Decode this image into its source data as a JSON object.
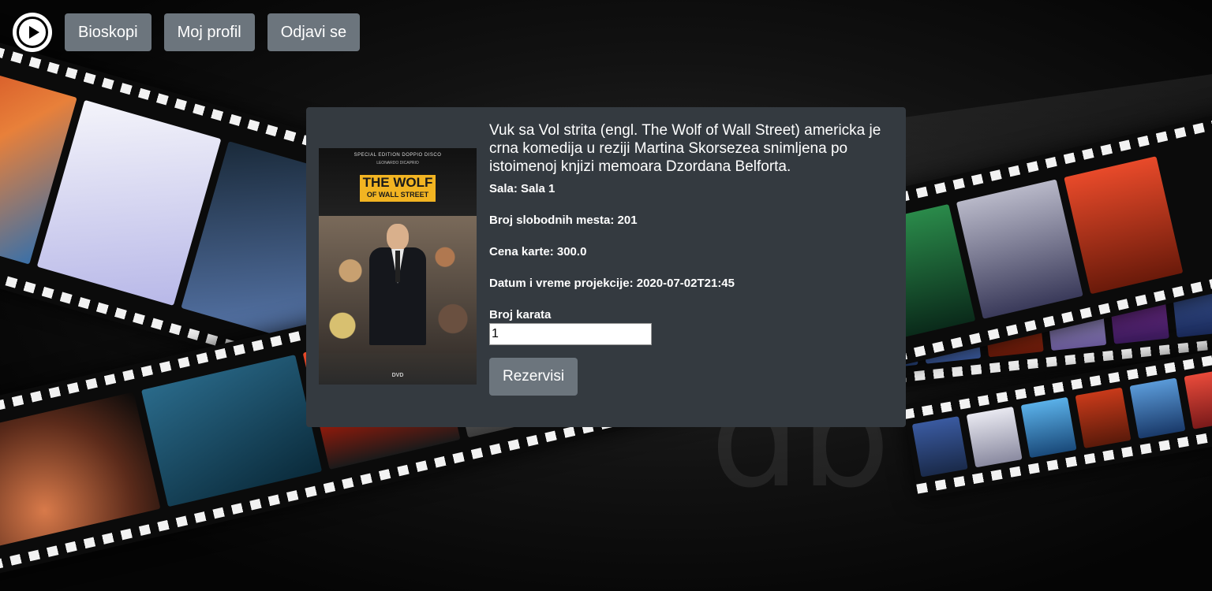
{
  "nav": {
    "logo_icon": "play-circle-icon",
    "items": [
      {
        "label": "Bioskopi"
      },
      {
        "label": "Moj profil"
      },
      {
        "label": "Odjavi se"
      }
    ]
  },
  "movie": {
    "description": "Vuk sa Vol strita (engl. The Wolf of Wall Street) americka je crna komedija u reziji Martina Skorsezea snimljena po istoimenoj knjizi memoara Dzordana Belforta.",
    "poster": {
      "edition": "SPECIAL EDITION DOPPIO DISCO",
      "actor": "LEONARDO DICAPRIO",
      "title_line1": "THE WOLF",
      "title_line2": "OF WALL STREET",
      "format": "DVD"
    },
    "hall": "Sala: Sala 1",
    "free_seats": "Broj slobodnih mesta: 201",
    "price": "Cena karte: 300.0",
    "datetime": "Datum i vreme projekcije: 2020-07-02T21:45"
  },
  "form": {
    "tickets_label": "Broj karata",
    "tickets_value": "1",
    "submit_label": "Rezervisi"
  },
  "colors": {
    "button_bg": "#6c757d",
    "card_bg": "#343a40",
    "text": "#ffffff"
  }
}
